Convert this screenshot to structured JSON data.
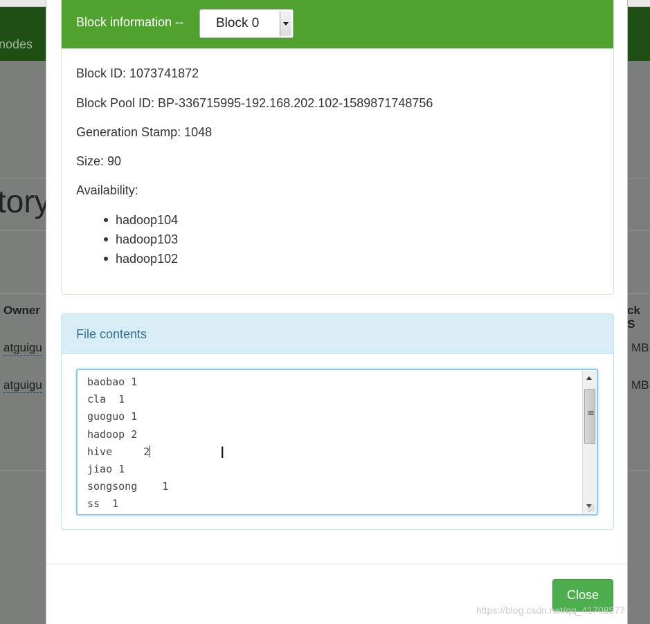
{
  "background": {
    "nav_text": "nodes",
    "heading": "tory",
    "table_header_owner": "Owner",
    "table_header_block": "ck S",
    "rows": [
      {
        "owner": "atguigu",
        "size": "MB"
      },
      {
        "owner": "atguigu",
        "size": "MB"
      }
    ]
  },
  "modal": {
    "block_panel": {
      "title": "Block information --",
      "selected_block": "Block 0",
      "block_id": "Block ID: 1073741872",
      "block_pool_id": "Block Pool ID: BP-336715995-192.168.202.102-1589871748756",
      "generation_stamp": "Generation Stamp: 1048",
      "size": "Size: 90",
      "availability_label": "Availability:",
      "availability": [
        "hadoop104",
        "hadoop103",
        "hadoop102"
      ]
    },
    "file_panel": {
      "title": "File contents",
      "lines": [
        "baobao 1",
        "cla  1",
        "guoguo 1",
        "hadoop 2",
        "hive     2",
        "jiao 1",
        "songsong    1",
        "ss  1"
      ]
    },
    "close_label": "Close"
  },
  "watermark": "https://blog.csdn.net/qq_41708577",
  "colors": {
    "block_header": "#4fa22e",
    "file_header": "#d9edf7",
    "close_button": "#4cae4c"
  }
}
